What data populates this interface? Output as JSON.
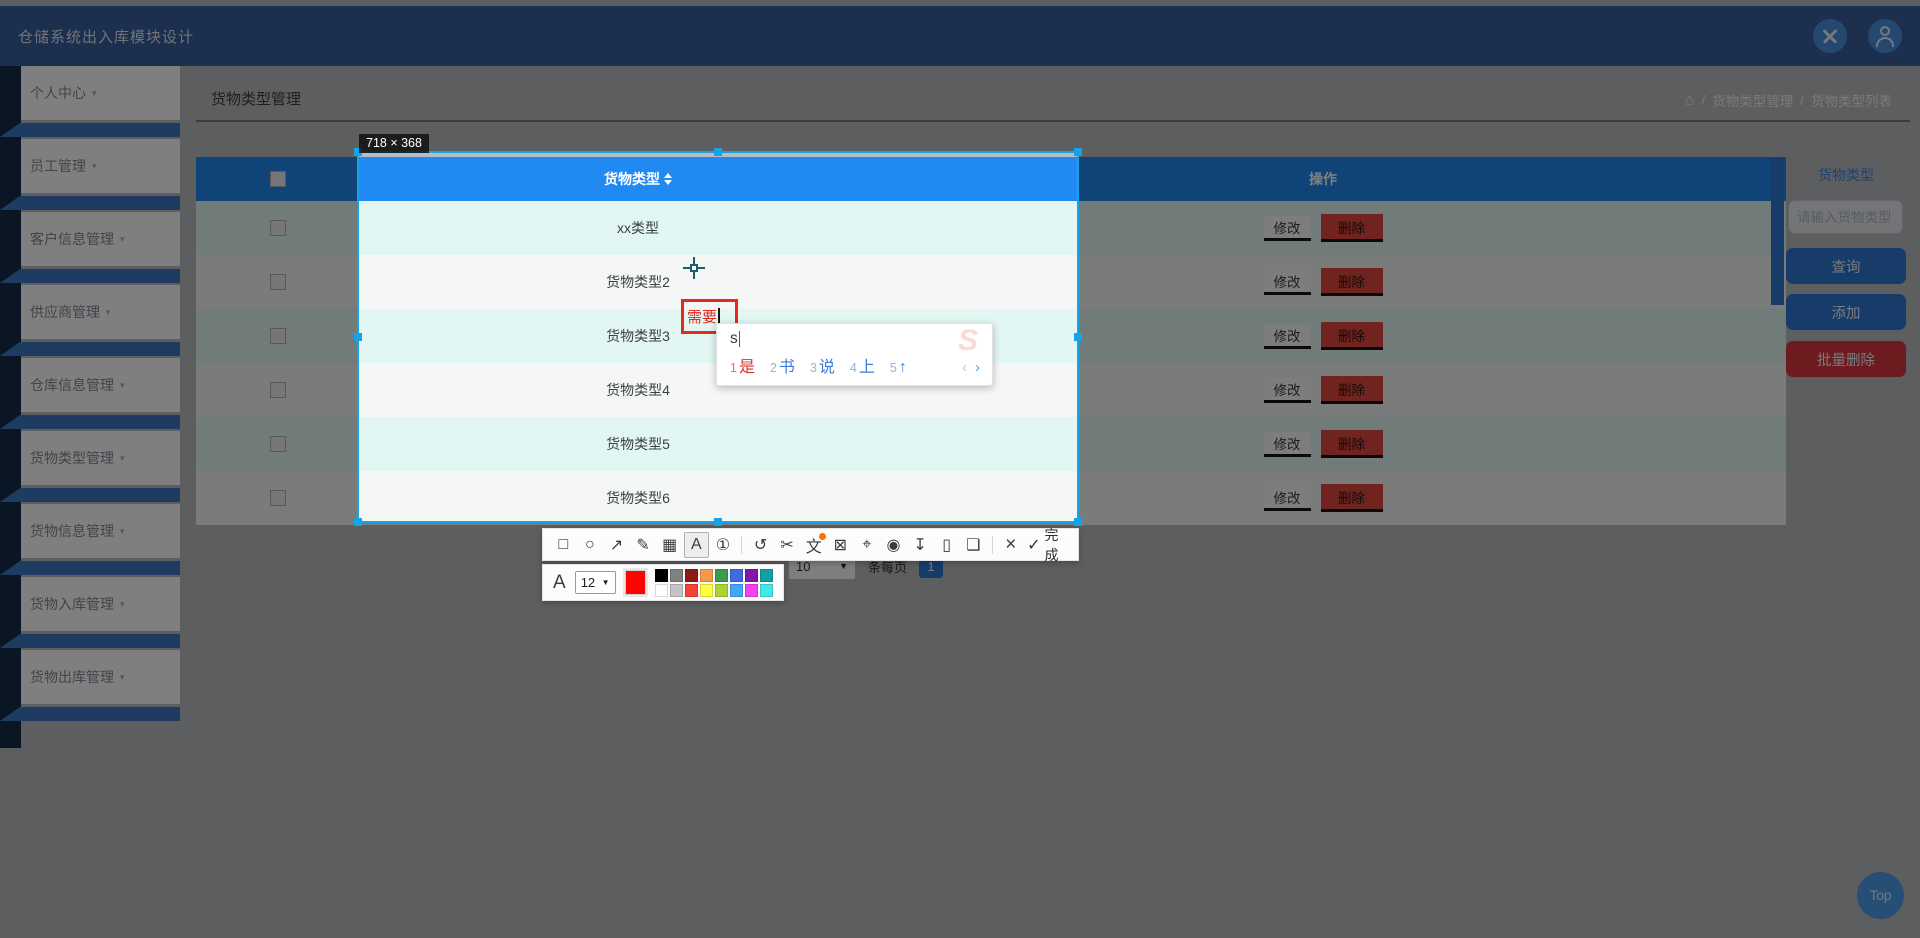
{
  "topbar": {
    "title": "仓储系统出入库模块设计"
  },
  "sidebar": {
    "items": [
      {
        "label": "个人中心"
      },
      {
        "label": "员工管理"
      },
      {
        "label": "客户信息管理"
      },
      {
        "label": "供应商管理"
      },
      {
        "label": "仓库信息管理"
      },
      {
        "label": "货物类型管理"
      },
      {
        "label": "货物信息管理"
      },
      {
        "label": "货物入库管理"
      },
      {
        "label": "货物出库管理"
      }
    ],
    "caret": "▾"
  },
  "page": {
    "title": "货物类型管理",
    "home_icon": "⌂",
    "sep": "/",
    "breadcrumb": [
      {
        "label": "货物类型管理"
      },
      {
        "label": "货物类型列表"
      }
    ]
  },
  "table": {
    "header": {
      "type": "货物类型",
      "ops": "操作"
    },
    "rows": [
      {
        "type": "xx类型"
      },
      {
        "type": "货物类型2"
      },
      {
        "type": "货物类型3"
      },
      {
        "type": "货物类型4"
      },
      {
        "type": "货物类型5"
      },
      {
        "type": "货物类型6"
      }
    ],
    "modify_label": "修改",
    "delete_label": "删除"
  },
  "pagination": {
    "page_size": "10",
    "caret": "▼",
    "per_page_label": "条每页",
    "current_page": "1"
  },
  "panel": {
    "label": "货物类型",
    "placeholder": "请输入货物类型",
    "search": "查询",
    "add": "添加",
    "batch_delete": "批量删除"
  },
  "backtop": {
    "label": "Top"
  },
  "capture": {
    "size_label": "718 × 368",
    "textbox_text": "需要",
    "toolbar": {
      "icons": [
        {
          "name": "rect-tool-icon",
          "glyph": "□"
        },
        {
          "name": "ellipse-tool-icon",
          "glyph": "○"
        },
        {
          "name": "arrow-tool-icon",
          "glyph": "↗"
        },
        {
          "name": "pen-tool-icon",
          "glyph": "✎"
        },
        {
          "name": "mosaic-tool-icon",
          "glyph": "▦"
        },
        {
          "name": "text-tool-icon",
          "glyph": "A"
        },
        {
          "name": "step-number-tool-icon",
          "glyph": "①"
        },
        {
          "name": "undo-icon",
          "glyph": "↺"
        },
        {
          "name": "cut-icon",
          "glyph": "✂"
        },
        {
          "name": "translate-icon",
          "glyph": "文"
        },
        {
          "name": "ocr-icon",
          "glyph": "⊠"
        },
        {
          "name": "pin-icon",
          "glyph": "⌖"
        },
        {
          "name": "record-icon",
          "glyph": "◉"
        },
        {
          "name": "download-icon",
          "glyph": "↧"
        },
        {
          "name": "phone-icon",
          "glyph": "▯"
        },
        {
          "name": "bookmark-icon",
          "glyph": "❏"
        },
        {
          "name": "cancel-icon",
          "glyph": "×"
        }
      ],
      "done_check": "✓",
      "done_label": "完成"
    },
    "font_tool": {
      "letter": "A",
      "size": "12",
      "caret": "▼",
      "current_color": "#fb0500"
    },
    "palette": [
      "#000000",
      "#808080",
      "#8b1a1a",
      "#f59a49",
      "#3a9b4c",
      "#4169e1",
      "#8318a8",
      "#14a0a0",
      "#ffffff",
      "#c4c4c4",
      "#f44336",
      "#ffff40",
      "#aad333",
      "#42a5f5",
      "#f042f0",
      "#40e8e8"
    ],
    "ime": {
      "composition": "s",
      "candidates": [
        {
          "n": "1",
          "t": "是"
        },
        {
          "n": "2",
          "t": "书"
        },
        {
          "n": "3",
          "t": "说"
        },
        {
          "n": "4",
          "t": "上"
        },
        {
          "n": "5",
          "t": "↑"
        }
      ],
      "prev": "‹",
      "next": "›",
      "watermark": "S"
    }
  },
  "colors": {
    "header_blue": "#2089f2",
    "selection_border": "#16a3e8",
    "annotation_red": "#e8281e",
    "button_blue": "#2e78d2",
    "danger_red": "#d9363e",
    "row_cyan": "#e2f6f3",
    "topbar_navy": "#3a5f9e"
  }
}
